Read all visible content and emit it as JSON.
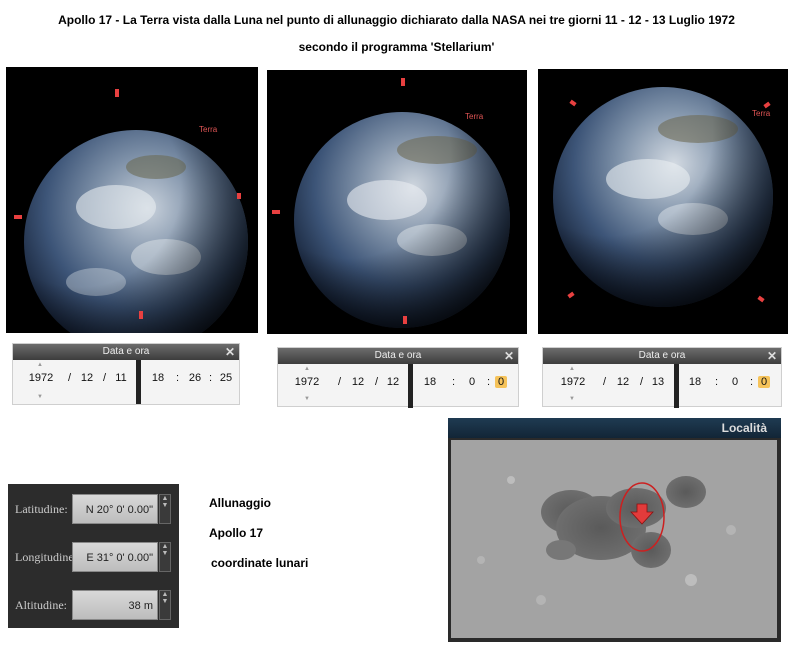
{
  "header": {
    "title": "Apollo 17 - La Terra vista dalla Luna nel punto di allunaggio dichiarato dalla NASA nei tre giorni   11 - 12 - 13   Luglio 1972",
    "subtitle": "secondo il programma 'Stellarium'"
  },
  "views": [
    {
      "label": "Terra"
    },
    {
      "label": "Terra"
    },
    {
      "label": "Terra"
    }
  ],
  "datetime_panels": [
    {
      "title": "Data e ora",
      "year": "1972",
      "month": "12",
      "day": "11",
      "hour": "18",
      "minute": "26",
      "second": "25"
    },
    {
      "title": "Data e ora",
      "year": "1972",
      "month": "12",
      "day": "12",
      "hour": "18",
      "minute": "0",
      "second": "0"
    },
    {
      "title": "Data e ora",
      "year": "1972",
      "month": "12",
      "day": "13",
      "hour": "18",
      "minute": "0",
      "second": "0"
    }
  ],
  "coordinates": {
    "latitude_label": "Latitudine:",
    "latitude_value": "N 20° 0' 0.00\"",
    "longitude_label": "Longitudine:",
    "longitude_value": "E 31° 0' 0.00\"",
    "altitude_label": "Altitudine:",
    "altitude_value": "38 m"
  },
  "info": {
    "line1": "Allunaggio",
    "line2": "Apollo 17",
    "line3": "coordinate lunari"
  },
  "location_panel": {
    "title": "Località"
  },
  "colors": {
    "marker": "#e23b3b",
    "ellipse": "#cc2020",
    "highlight": "#f6c35a"
  },
  "icons": {
    "close": "close-icon",
    "spin": "spinner-arrows-icon",
    "pin": "location-pin-icon"
  }
}
